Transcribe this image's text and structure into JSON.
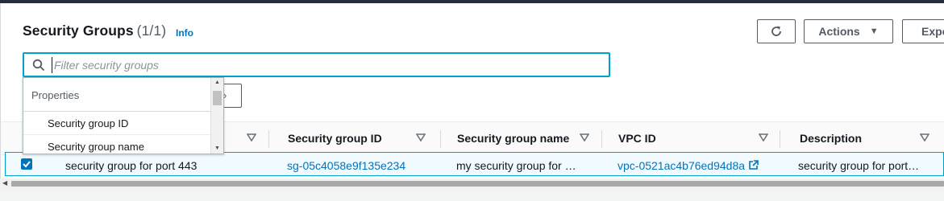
{
  "header": {
    "title": "Security Groups",
    "count": "(1/1)",
    "info_label": "Info"
  },
  "toolbar": {
    "refresh_icon": "refresh-icon",
    "actions_label": "Actions",
    "export_label": "Expo"
  },
  "search": {
    "placeholder": "Filter security groups",
    "value": ""
  },
  "property_dropdown": {
    "header": "Properties",
    "options": [
      "Security group ID",
      "Security group name"
    ]
  },
  "table": {
    "columns": [
      "Security group ID",
      "Security group name",
      "VPC ID",
      "Description"
    ],
    "rows": [
      {
        "selected": true,
        "name": "security group for port 443",
        "security_group_id": "sg-05c4058e9f135e234",
        "security_group_name": "my security group for …",
        "vpc_id": "vpc-0521ac4b76ed94d8a",
        "description": "security group for port…"
      }
    ]
  },
  "colors": {
    "accent": "#0073bb",
    "focus": "#00a1c9",
    "selected_row_bg": "#f1faff",
    "topbar": "#232f3e"
  }
}
